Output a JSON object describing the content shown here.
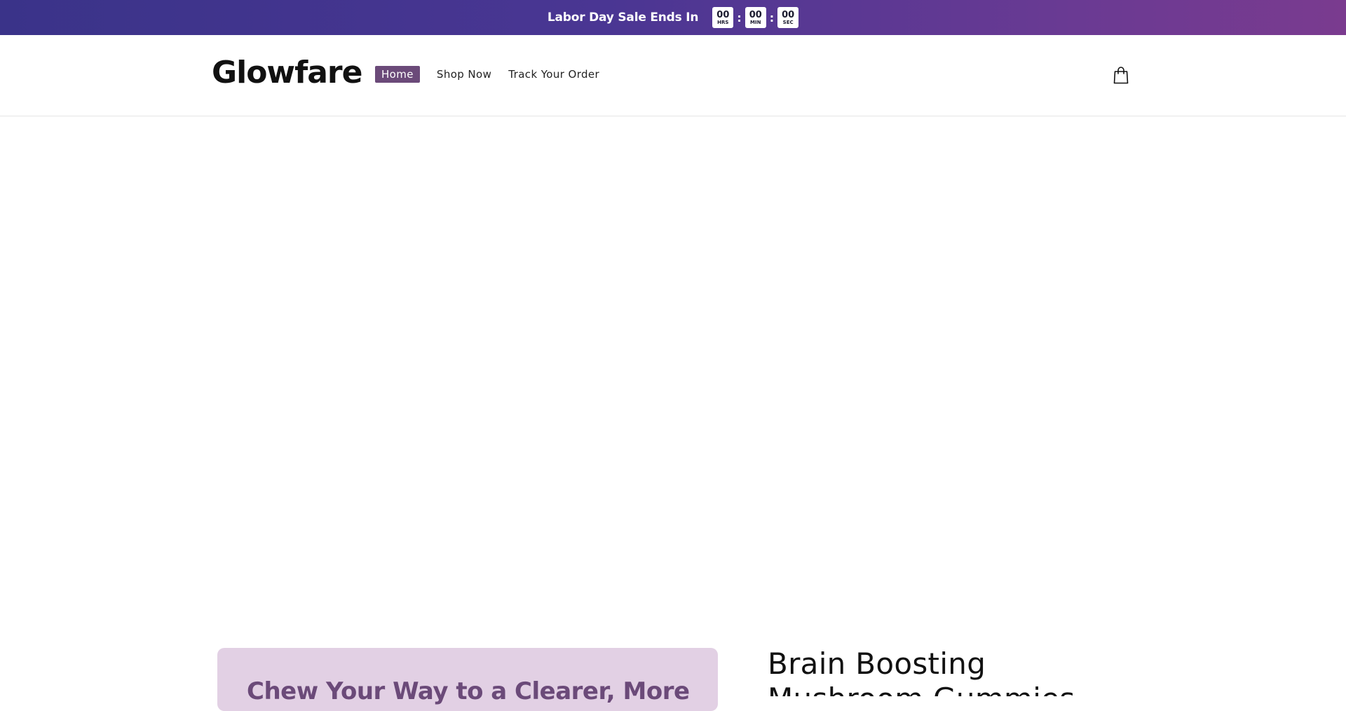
{
  "announcement": {
    "message": "Labor Day Sale Ends In",
    "timer": [
      {
        "value": "00",
        "unit": "HRS"
      },
      {
        "value": "00",
        "unit": "MIN"
      },
      {
        "value": "00",
        "unit": "SEC"
      }
    ],
    "separator": ":",
    "colors": {
      "gradient_start": "#3a3389",
      "gradient_end": "#7a3b8f"
    }
  },
  "header": {
    "logo": "Glowfare",
    "nav": [
      {
        "label": "Home",
        "active": true
      },
      {
        "label": "Shop Now",
        "active": false
      },
      {
        "label": "Track Your Order",
        "active": false
      }
    ],
    "cart_icon": "shopping-bag-icon",
    "accent_color": "#6b4a79"
  },
  "main": {
    "promo_headline": "Chew Your Way to a Clearer, More",
    "product_title": "Brain Boosting Mushroom Gummies",
    "promo_bg_color": "#e2d0e4"
  }
}
